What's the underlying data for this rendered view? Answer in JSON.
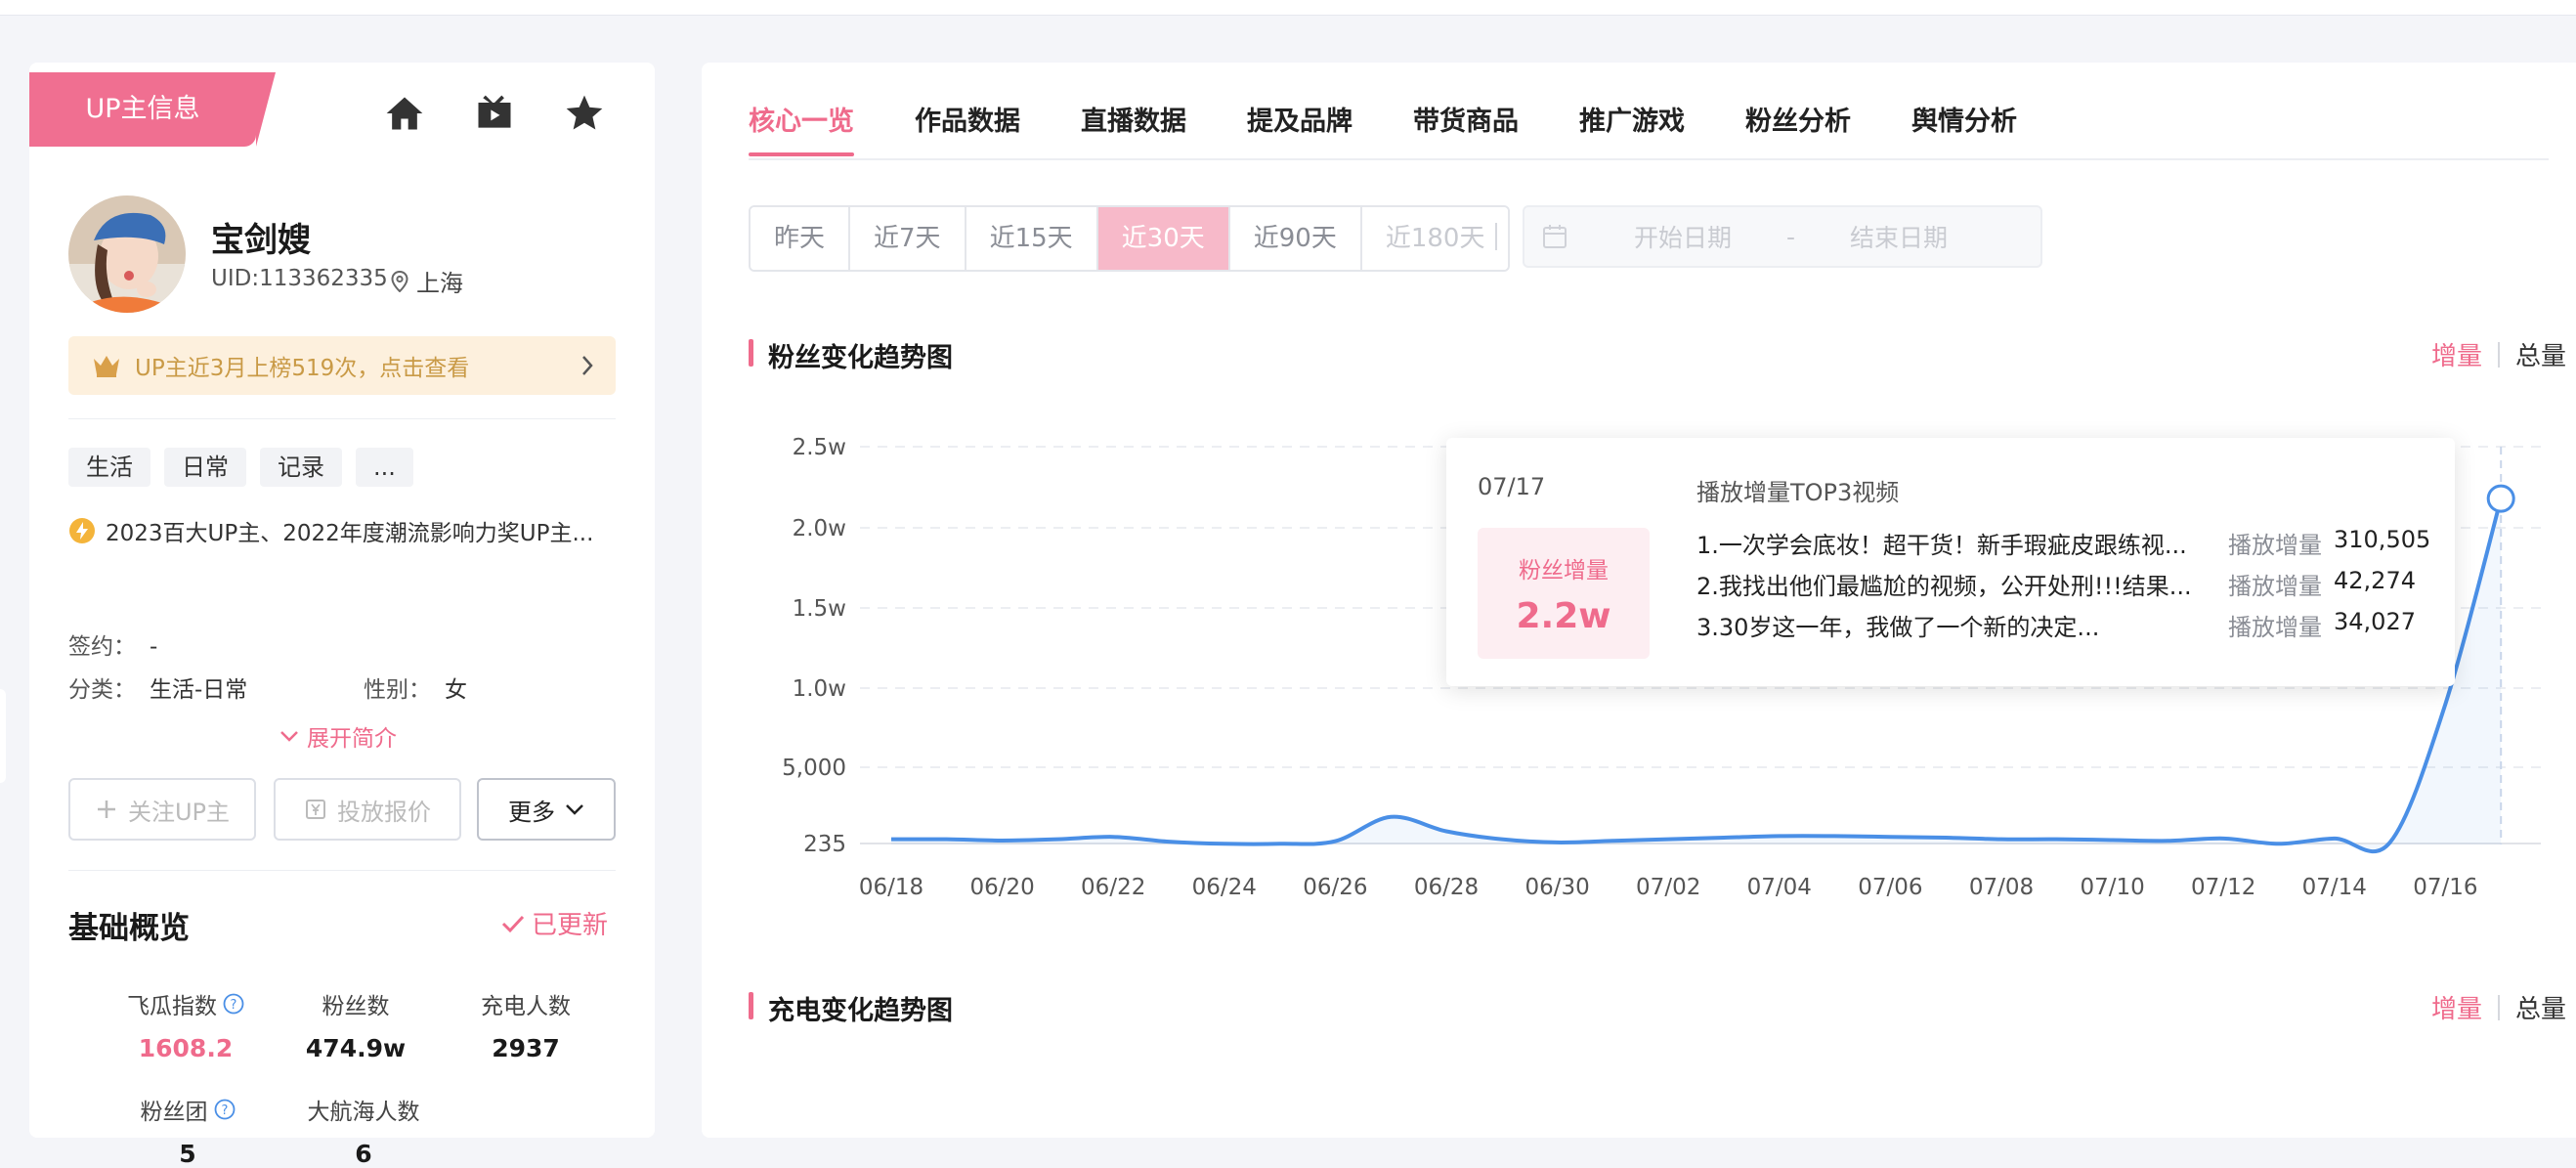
{
  "up_tab": "UP主信息",
  "profile": {
    "name": "宝剑嫂",
    "uid": "UID:113362335",
    "location": "上海",
    "rank_banner": "UP主近3月上榜519次，点击查看",
    "tags": [
      "生活",
      "日常",
      "记录",
      "..."
    ],
    "award": "2023百大UP主、2022年度潮流影响力奖UP主...",
    "sign_label": "签约：",
    "sign_value": "-",
    "category_label": "分类：",
    "category_value": "生活-日常",
    "gender_label": "性别：",
    "gender_value": "女",
    "expand_label": "展开简介"
  },
  "actions": {
    "follow": "关注UP主",
    "quote": "投放报价",
    "more": "更多"
  },
  "overview": {
    "title": "基础概览",
    "updated": "已更新",
    "stats": [
      {
        "label": "飞瓜指数",
        "value": "1608.2"
      },
      {
        "label": "粉丝数",
        "value": "474.9w"
      },
      {
        "label": "充电人数",
        "value": "2937"
      },
      {
        "label": "粉丝团",
        "value": "5"
      },
      {
        "label": "大航海人数",
        "value": "6"
      }
    ]
  },
  "nav": {
    "tabs": [
      "核心一览",
      "作品数据",
      "直播数据",
      "提及品牌",
      "带货商品",
      "推广游戏",
      "粉丝分析",
      "舆情分析"
    ],
    "active": 0
  },
  "range": {
    "options": [
      "昨天",
      "近7天",
      "近15天",
      "近30天",
      "近90天",
      "近180天"
    ],
    "active": 3,
    "disabled": 5,
    "start_placeholder": "开始日期",
    "dash": "-",
    "end_placeholder": "结束日期"
  },
  "fans_chart": {
    "title": "粉丝变化趋势图",
    "mode_on": "增量",
    "mode_off": "总量"
  },
  "charge_chart": {
    "title": "充电变化趋势图",
    "mode_on": "增量",
    "mode_off": "总量"
  },
  "tooltip": {
    "date": "07/17",
    "heading": "播放增量TOP3视频",
    "fans_label": "粉丝增量",
    "fans_value": "2.2w",
    "videos": [
      {
        "title": "1.一次学会底妆！超干货！新手瑕疵皮跟练视...",
        "label": "播放增量",
        "value": "310,505"
      },
      {
        "title": "2.我找出他们最尴尬的视频，公开处刑!!!结果...",
        "label": "播放增量",
        "value": "42,274"
      },
      {
        "title": "3.30岁这一年，我做了一个新的决定...",
        "label": "播放增量",
        "value": "34,027"
      }
    ]
  },
  "colors": {
    "accent": "#ef6b8c",
    "line": "#4a8fe6"
  },
  "chart_data": {
    "type": "area",
    "x": [
      "06/18",
      "06/19",
      "06/20",
      "06/21",
      "06/22",
      "06/23",
      "06/24",
      "06/25",
      "06/26",
      "06/27",
      "06/28",
      "06/29",
      "06/30",
      "07/01",
      "07/02",
      "07/03",
      "07/04",
      "07/05",
      "07/06",
      "07/07",
      "07/08",
      "07/09",
      "07/10",
      "07/11",
      "07/12",
      "07/13",
      "07/14",
      "07/15",
      "07/16",
      "07/17"
    ],
    "x_tick_labels": [
      "06/18",
      "06/20",
      "06/22",
      "06/24",
      "06/26",
      "06/28",
      "06/30",
      "07/02",
      "07/04",
      "07/06",
      "07/08",
      "07/10",
      "07/12",
      "07/14",
      "07/16"
    ],
    "y_ticks": [
      235,
      5000,
      10000,
      15000,
      20000,
      25000
    ],
    "y_tick_labels": [
      "235",
      "5,000",
      "1.0w",
      "1.5w",
      "2.0w",
      "2.5w"
    ],
    "series": [
      {
        "values": [
          500,
          500,
          420,
          500,
          650,
          350,
          200,
          200,
          380,
          1900,
          1000,
          500,
          300,
          400,
          500,
          600,
          700,
          700,
          650,
          600,
          500,
          500,
          450,
          400,
          550,
          200,
          550,
          300,
          9000,
          21800
        ]
      }
    ],
    "ylim": [
      0,
      25000
    ],
    "grid": true,
    "highlight_x": "07/17"
  }
}
